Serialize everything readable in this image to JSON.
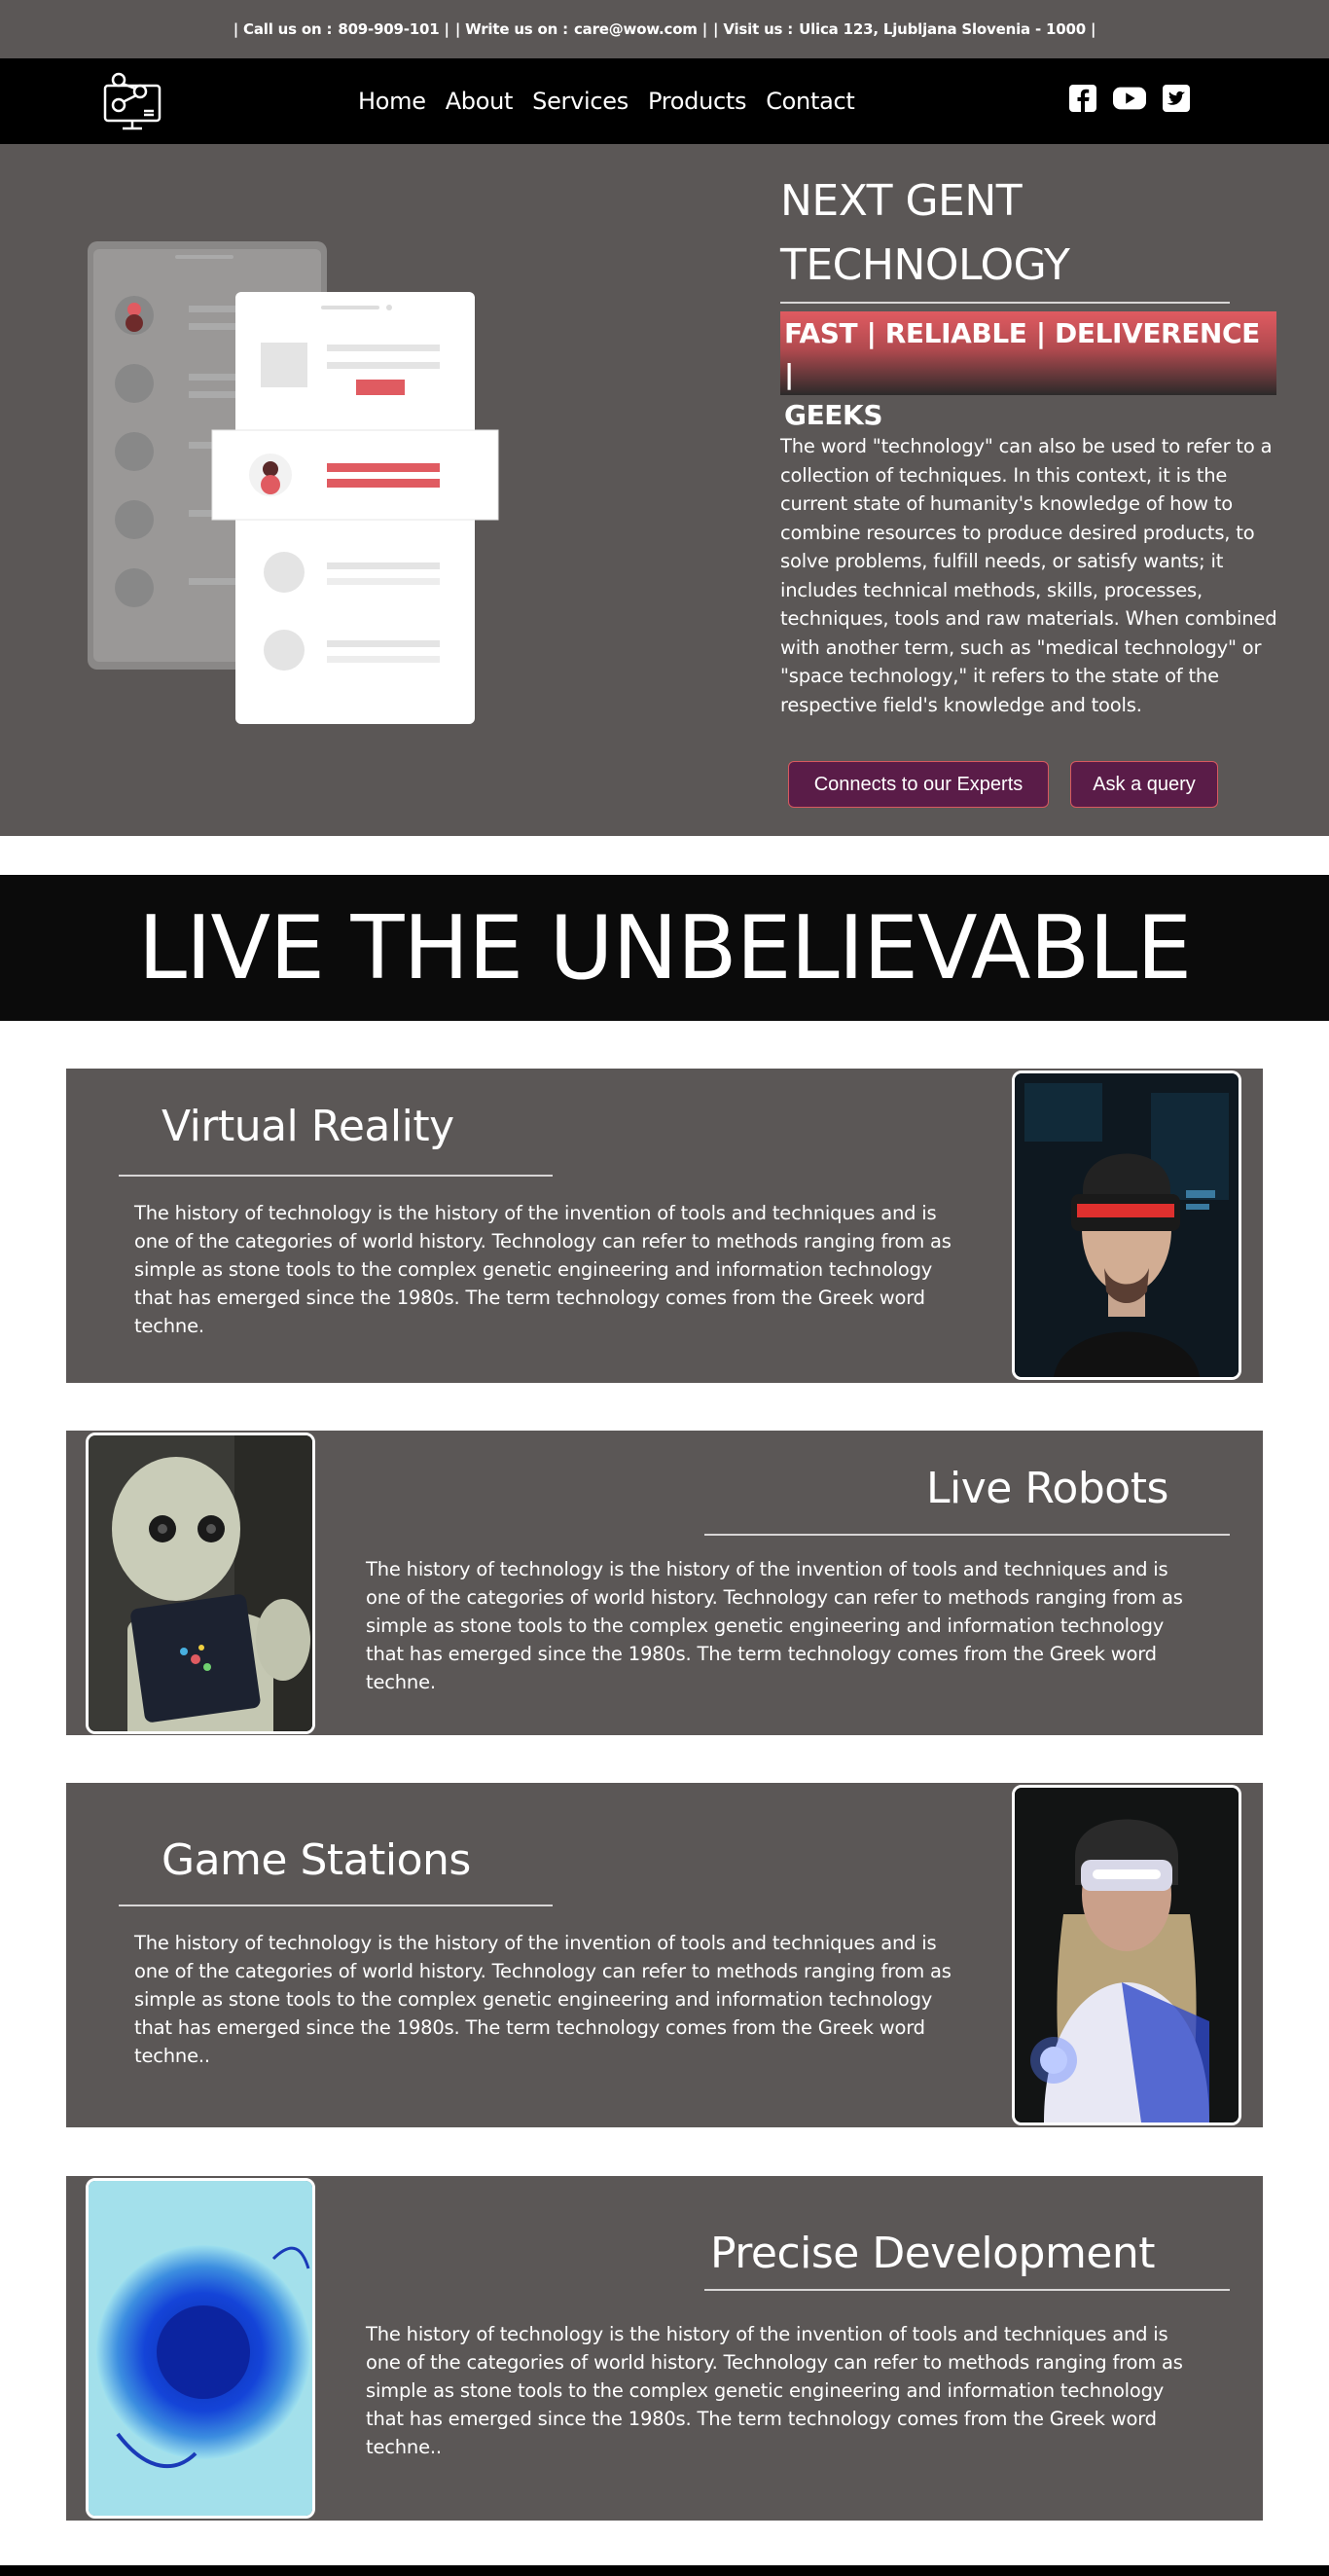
{
  "topbar": {
    "call_label": "| Call us on :",
    "call_value": "809-909-101 |",
    "write_label": "| Write us on :",
    "write_value": "care@wow.com |",
    "visit_label": "| Visit us :",
    "visit_value": "Ulica 123, Ljubljana Slovenia - 1000 |"
  },
  "nav": {
    "logo_icon": "network-monitor-icon",
    "items": [
      "Home",
      "About",
      "Services",
      "Products",
      "Contact"
    ],
    "social": [
      "facebook-icon",
      "youtube-icon",
      "twitter-icon"
    ]
  },
  "hero": {
    "title_line1": "NEXT GENT",
    "title_line2": "TECHNOLOGY",
    "tagline_line1": "FAST | RELIABLE | DELIVERENCE |",
    "tagline_line2": "GEEKS",
    "paragraph": "The word \"technology\" can also be used to refer to a collection of techniques. In this context, it is the current state of humanity's knowledge of how to combine resources to produce desired products, to solve problems, fulfill needs, or satisfy wants; it includes technical methods, skills, processes, techniques, tools and raw materials. When combined with another term, such as \"medical technology\" or \"space technology,\" it refers to the state of the respective field's knowledge and tools.",
    "button_experts": "Connects to our Experts",
    "button_query": "Ask a query"
  },
  "banner": {
    "text": "LIVE THE UNBELIEVABLE"
  },
  "features": [
    {
      "title": "Virtual Reality",
      "text": "The history of technology is the history of the invention of tools and techniques and is one of the categories of world history. Technology can refer to methods ranging from as simple as stone tools to the complex genetic engineering and information technology that has emerged since the 1980s. The term technology comes from the Greek word techne."
    },
    {
      "title": "Live Robots",
      "text": "The history of technology is the history of the invention of tools and techniques and is one of the categories of world history. Technology can refer to methods ranging from as simple as stone tools to the complex genetic engineering and information technology that has emerged since the 1980s. The term technology comes from the Greek word techne."
    },
    {
      "title": "Game Stations",
      "text": "The history of technology is the history of the invention of tools and techniques and is one of the categories of world history. Technology can refer to methods ranging from as simple as stone tools to the complex genetic engineering and information technology that has emerged since the 1980s. The term technology comes from the Greek word techne.."
    },
    {
      "title": "Precise Development",
      "text": "The history of technology is the history of the invention of tools and techniques and is one of the categories of world history. Technology can refer to methods ranging from as simple as stone tools to the complex genetic engineering and information technology that has emerged since the 1980s. The term technology comes from the Greek word techne.."
    }
  ],
  "colors": {
    "panel": "#5b5756",
    "accent": "#e05b61",
    "button": "#5a1c48"
  }
}
